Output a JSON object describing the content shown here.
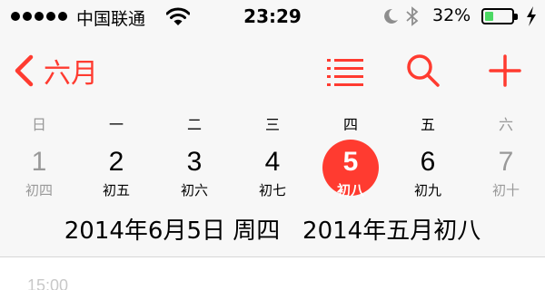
{
  "status_bar": {
    "carrier": "中国联通",
    "time": "23:29",
    "battery_percent": "32%",
    "battery_level": 0.32,
    "signal_bars": 5,
    "icons": [
      "signal-dots-icon",
      "wifi-icon",
      "moon-icon",
      "bluetooth-icon",
      "battery-icon",
      "charging-bolt-icon"
    ]
  },
  "nav": {
    "back_label": "六月",
    "icons": [
      "chevron-left-icon",
      "list-icon",
      "search-icon",
      "plus-icon"
    ]
  },
  "week": {
    "headers": [
      "日",
      "一",
      "二",
      "三",
      "四",
      "五",
      "六"
    ],
    "days": [
      {
        "num": "1",
        "lunar": "初四"
      },
      {
        "num": "2",
        "lunar": "初五"
      },
      {
        "num": "3",
        "lunar": "初六"
      },
      {
        "num": "4",
        "lunar": "初七"
      },
      {
        "num": "5",
        "lunar": "初八",
        "selected": true
      },
      {
        "num": "6",
        "lunar": "初九"
      },
      {
        "num": "7",
        "lunar": "初十"
      }
    ]
  },
  "selected_date_text": "2014年6月5日 周四   2014年五月初八",
  "event_time_partial": "15:00",
  "colors": {
    "accent": "#ff3b30",
    "weekend_gray": "#999999",
    "battery_green": "#4cd964",
    "header_bg": "#f7f7f7"
  }
}
